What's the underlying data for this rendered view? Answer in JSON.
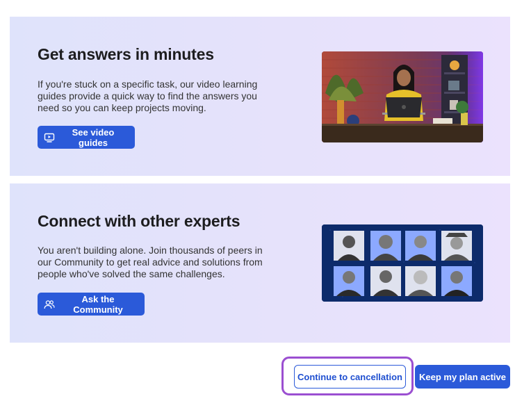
{
  "cards": [
    {
      "title": "Get answers in minutes",
      "body": "If you're stuck on a specific task, our video learning guides provide a quick way to find the answers you need so you can keep projects moving.",
      "button_label": "See video guides",
      "button_icon": "video-play-icon"
    },
    {
      "title": "Connect with other experts",
      "body": "You aren't building alone. Join thousands of peers in our Community to get real advice and solutions from people who've solved the same challenges.",
      "button_label": "Ask the Community",
      "button_icon": "people-icon"
    }
  ],
  "footer": {
    "continue_label": "Continue to cancellation",
    "keep_label": "Keep my plan active"
  },
  "colors": {
    "primary": "#2b5ad9",
    "focus_ring": "#9b4fd1",
    "card_bg_start": "#dfe3fb",
    "card_bg_end": "#ebe2fd"
  }
}
